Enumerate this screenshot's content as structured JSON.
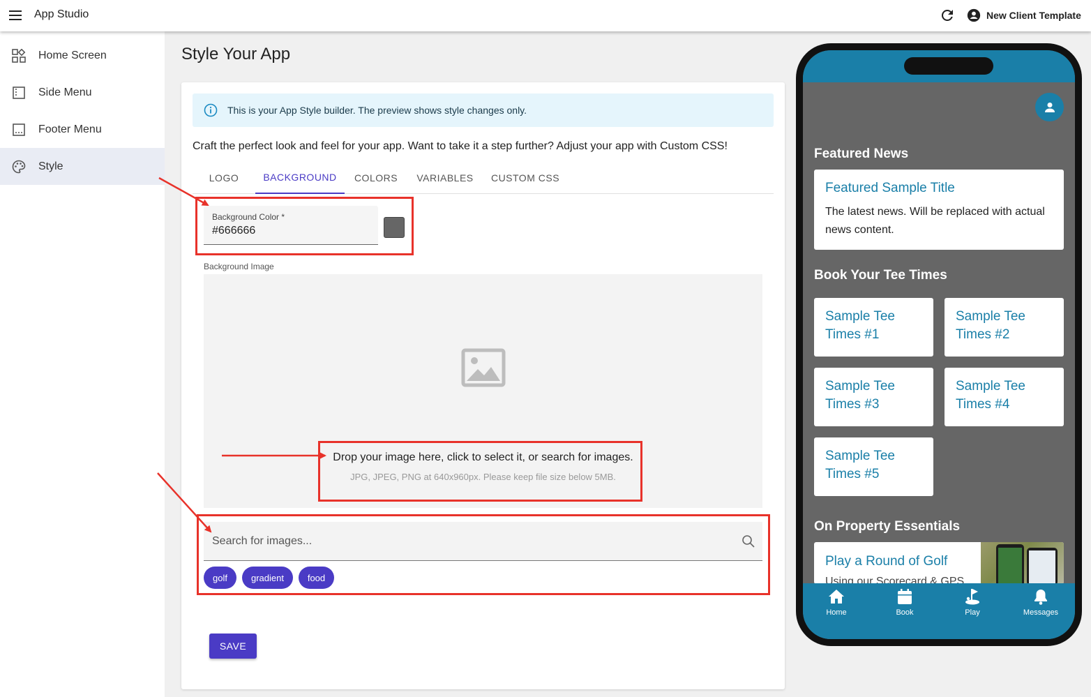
{
  "topbar": {
    "app_title": "App Studio",
    "template_name": "New Client Template"
  },
  "sidebar": {
    "items": [
      {
        "label": "Home Screen",
        "icon": "dashboard-icon"
      },
      {
        "label": "Side Menu",
        "icon": "side-menu-icon"
      },
      {
        "label": "Footer Menu",
        "icon": "footer-menu-icon"
      },
      {
        "label": "Style",
        "icon": "palette-icon",
        "active": true
      }
    ]
  },
  "main": {
    "page_title": "Style Your App",
    "info_text": "This is your App Style builder. The preview shows style changes only.",
    "intro_text": "Craft the perfect look and feel for your app. Want to take it a step further? Adjust your app with Custom CSS!",
    "tabs": [
      {
        "label": "LOGO"
      },
      {
        "label": "BACKGROUND",
        "active": true
      },
      {
        "label": "COLORS"
      },
      {
        "label": "VARIABLES"
      },
      {
        "label": "CUSTOM CSS"
      }
    ],
    "background_color": {
      "label": "Background Color *",
      "value": "#666666"
    },
    "background_image": {
      "label": "Background Image",
      "drop_text": "Drop your image here, click to select it, or search for images.",
      "hint_text": "JPG, JPEG, PNG at 640x960px. Please keep file size below 5MB."
    },
    "search": {
      "placeholder": "Search for images..."
    },
    "chips": [
      {
        "label": "golf"
      },
      {
        "label": "gradient"
      },
      {
        "label": "food"
      }
    ],
    "save_label": "SAVE"
  },
  "preview": {
    "sections": {
      "featured": "Featured News",
      "tee_times": "Book Your Tee Times",
      "essentials": "On Property Essentials"
    },
    "featured_card": {
      "title": "Featured Sample Title",
      "body": "The latest news. Will be replaced with actual news content."
    },
    "tee_cards": [
      {
        "title": "Sample Tee Times #1"
      },
      {
        "title": "Sample Tee Times #2"
      },
      {
        "title": "Sample Tee Times #3"
      },
      {
        "title": "Sample Tee Times #4"
      },
      {
        "title": "Sample Tee Times #5"
      }
    ],
    "essentials_card": {
      "title": "Play a Round of Golf",
      "body": "Using our Scorecard & GPS"
    },
    "bottom_nav": [
      {
        "label": "Home",
        "icon": "home-icon"
      },
      {
        "label": "Book",
        "icon": "calendar-icon"
      },
      {
        "label": "Play",
        "icon": "golf-flag-icon"
      },
      {
        "label": "Messages",
        "icon": "bell-icon"
      }
    ]
  },
  "colors": {
    "accent": "#4a3bc5",
    "preview_primary": "#1a7fa8",
    "preview_background": "#666666",
    "annotation": "#e8322a"
  }
}
